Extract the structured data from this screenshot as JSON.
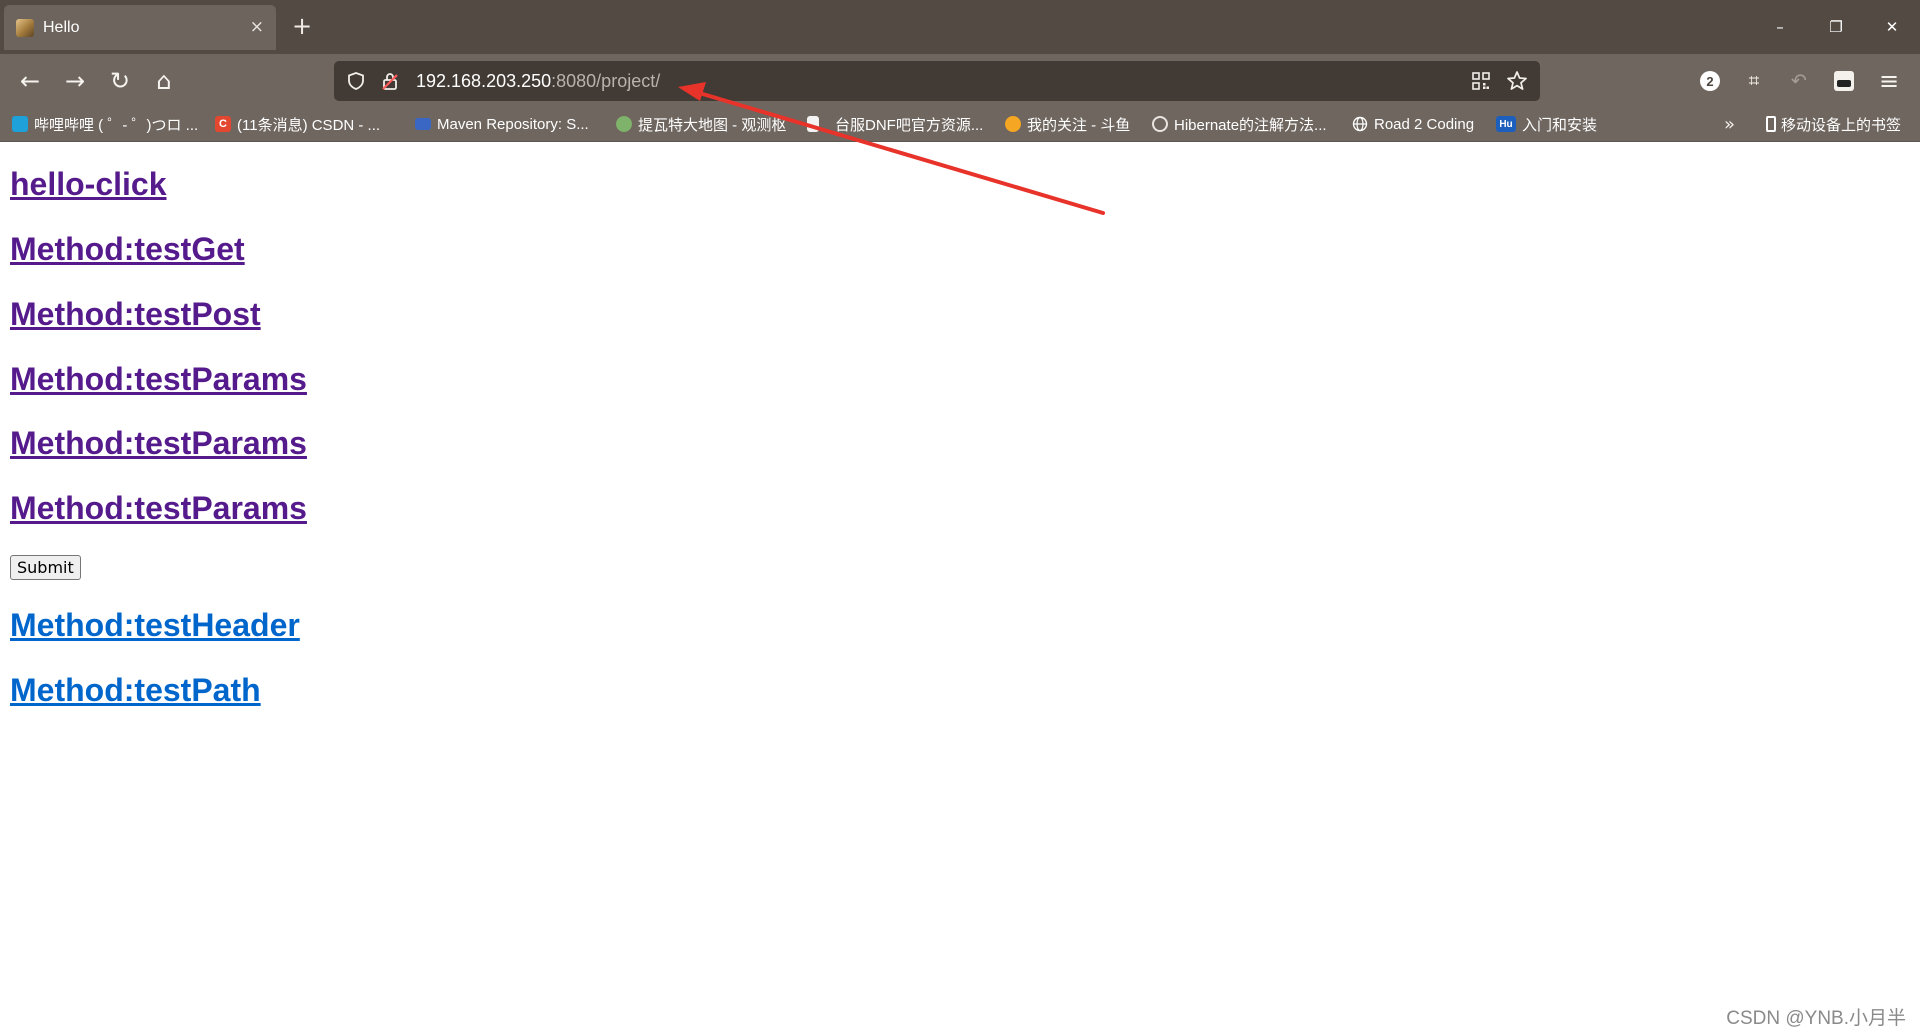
{
  "tab": {
    "title": "Hello",
    "close": "×"
  },
  "newtab": "+",
  "window": {
    "minimize": "–",
    "restore": "❐",
    "close": "✕"
  },
  "nav": {
    "back": "←",
    "forward": "→",
    "reload": "↻",
    "home": "⌂"
  },
  "url": {
    "host": "192.168.203.250",
    "rest": ":8080/project/"
  },
  "toolbar": {
    "badge": "2",
    "crop": "⌗",
    "undo": "↶",
    "menu": "≡"
  },
  "bookmarks": [
    {
      "label": "哔哩哔哩 ( ゜- ゜)つロ ...",
      "icon": "bilibili-icon",
      "color": "#1da1d8"
    },
    {
      "label": "(11条消息) CSDN - ...",
      "icon": "csdn-icon",
      "color": "#e4472f",
      "glyph": "C"
    },
    {
      "label": "Maven Repository: S...",
      "icon": "maven-icon",
      "color": "#3a66c4"
    },
    {
      "label": "提瓦特大地图 - 观测枢",
      "icon": "map-icon",
      "color": "#7fb26b"
    },
    {
      "label": "台服DNF吧官方资源...",
      "icon": "page-icon",
      "color": "#f3f3f3"
    },
    {
      "label": "我的关注 - 斗鱼",
      "icon": "douyu-icon",
      "color": "#f5a623"
    },
    {
      "label": "Hibernate的注解方法...",
      "icon": "hibernate-icon",
      "color": "#b9b2ab"
    },
    {
      "label": "Road 2 Coding",
      "icon": "globe-icon",
      "color": "#6e665f"
    },
    {
      "label": "入门和安装",
      "icon": "hu-icon",
      "color": "#1c5fbd",
      "glyph": "Hu"
    }
  ],
  "bookmarks_overflow": "»",
  "mobile_bookmarks": "移动设备上的书签",
  "links": [
    {
      "text": "hello-click"
    },
    {
      "text": "Method:testGet"
    },
    {
      "text": "Method:testPost"
    },
    {
      "text": "Method:testParams"
    },
    {
      "text": "Method:testParams"
    },
    {
      "text": "Method:testParams"
    },
    {
      "text": "Method:testHeader"
    },
    {
      "text": "Method:testPath"
    }
  ],
  "submit": "Submit",
  "watermark": "CSDN @YNB.小月半",
  "colors": {
    "visited_link": "#551a8b",
    "unvisited_link": "#0066cc",
    "annotation_arrow": "#e8332b"
  }
}
